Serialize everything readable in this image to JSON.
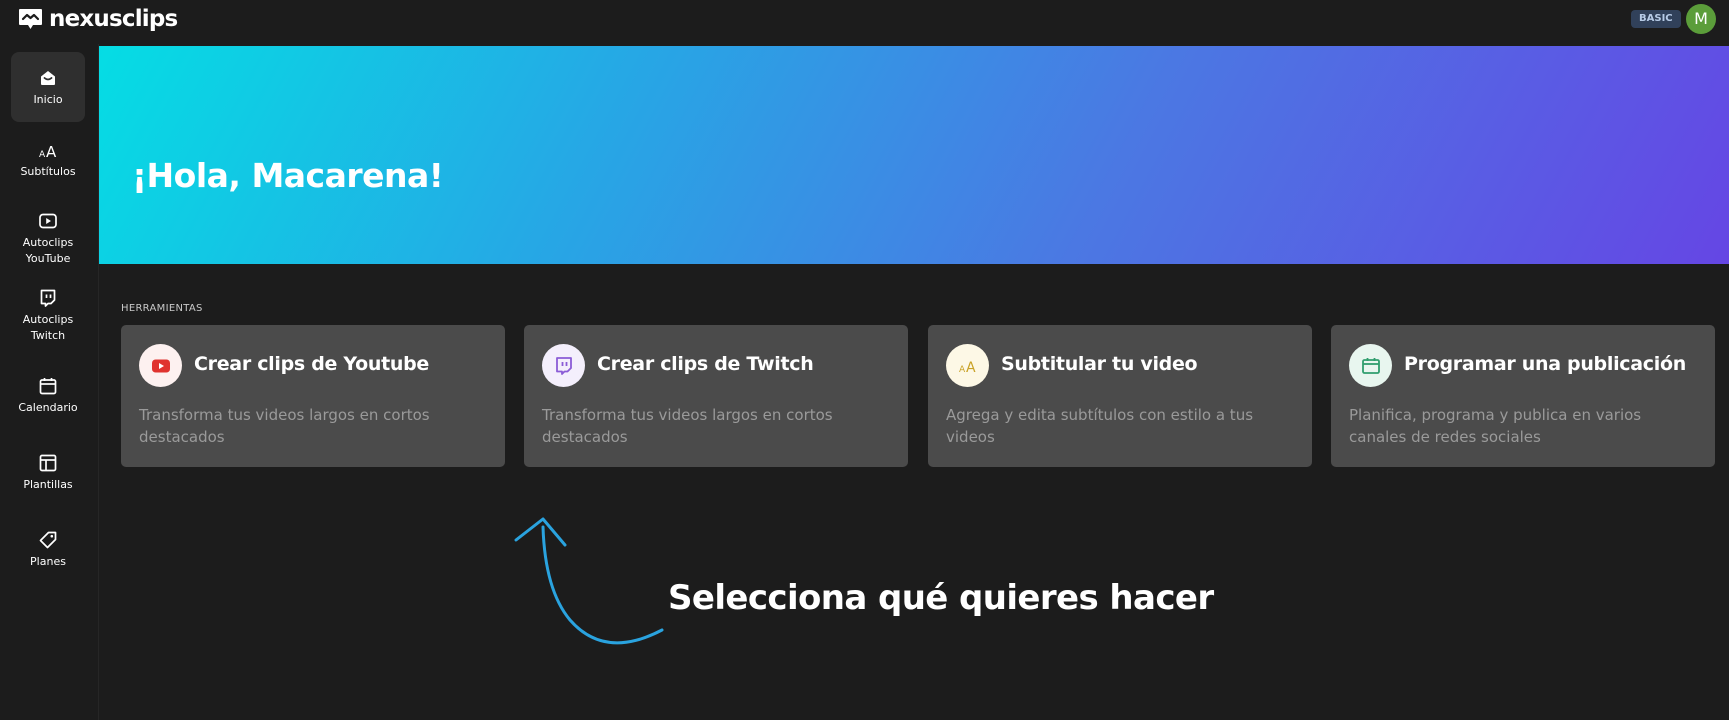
{
  "app": {
    "logo_text": "nexusclips",
    "plan_badge": "BASIC",
    "avatar_initial": "M",
    "avatar_color": "#5b9d3a"
  },
  "sidebar": {
    "items": [
      {
        "label": "Inicio",
        "icon": "home-icon",
        "active": true
      },
      {
        "label": "Subtítulos",
        "icon": "text-size-icon",
        "active": false
      },
      {
        "label": "Autoclips YouTube",
        "icon": "youtube-icon",
        "active": false
      },
      {
        "label": "Autoclips Twitch",
        "icon": "twitch-icon",
        "active": false
      },
      {
        "label": "Calendario",
        "icon": "calendar-icon",
        "active": false
      },
      {
        "label": "Plantillas",
        "icon": "template-icon",
        "active": false
      },
      {
        "label": "Planes",
        "icon": "tag-icon",
        "active": false
      }
    ]
  },
  "hero": {
    "greeting": "¡Hola, Macarena!",
    "gradient_colors": [
      "#05dde4",
      "#6546e4"
    ]
  },
  "tools": {
    "section_label": "HERRAMIENTAS",
    "cards": [
      {
        "title": "Crear clips de Youtube",
        "description": "Transforma tus videos largos en cortos destacados",
        "icon": "youtube-icon",
        "accent": "#e0332f"
      },
      {
        "title": "Crear clips de Twitch",
        "description": "Transforma tus videos largos en cortos destacados",
        "icon": "twitch-icon",
        "accent": "#8b5cd6"
      },
      {
        "title": "Subtitular tu video",
        "description": "Agrega y edita subtítulos con estilo a tus videos",
        "icon": "text-size-icon",
        "accent": "#c9a227"
      },
      {
        "title": "Programar una publicación",
        "description": "Planifica, programa y publica en varios canales de redes sociales",
        "icon": "calendar-icon",
        "accent": "#2f9e6e"
      }
    ]
  },
  "hint": {
    "text": "Selecciona qué quieres hacer",
    "arrow_color": "#2aa3df"
  }
}
